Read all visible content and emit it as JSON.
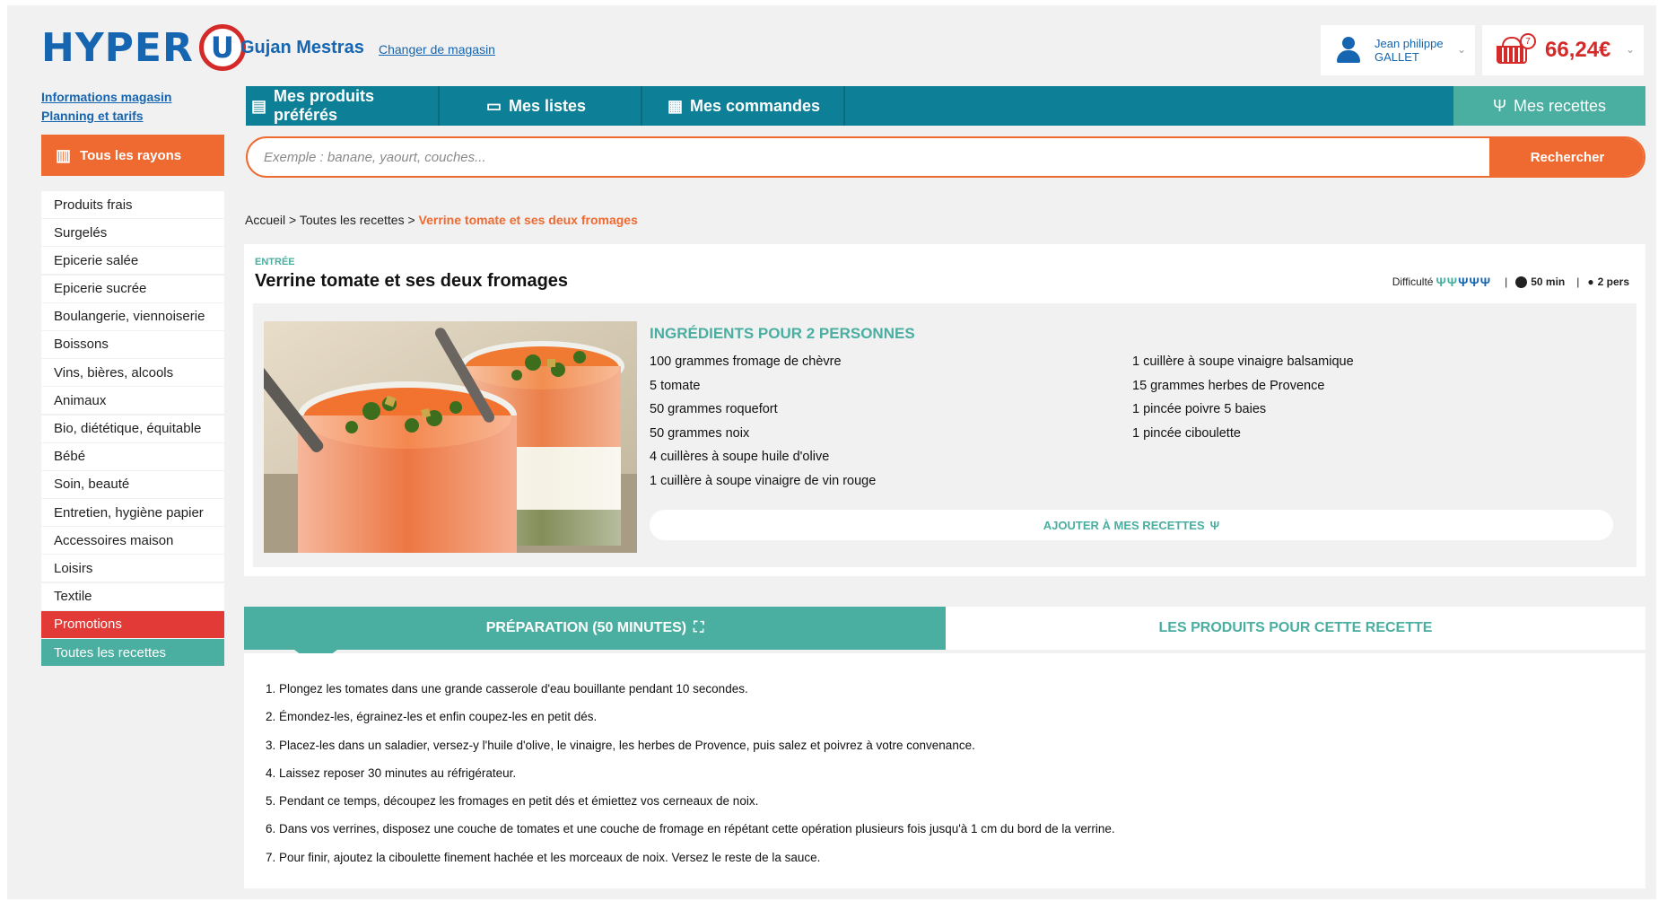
{
  "header": {
    "logo": {
      "text": "HYPER",
      "mark": "U"
    },
    "store_name": "Gujan Mestras",
    "change_store": "Changer de magasin",
    "user": {
      "first": "Jean philippe",
      "last": "GALLET"
    },
    "cart": {
      "count": "7",
      "total": "66,24€"
    }
  },
  "sidebar": {
    "info_link": "Informations magasin",
    "planning_link": "Planning et tarifs",
    "rayons_button": "Tous les rayons",
    "categories": [
      "Produits frais",
      "Surgelés",
      "Epicerie salée",
      "Epicerie sucrée",
      "Boulangerie, viennoiserie",
      "Boissons",
      "Vins, bières, alcools",
      "Animaux",
      "Bio, diététique, équitable",
      "Bébé",
      "Soin, beauté",
      "Entretien, hygiène papier",
      "Accessoires maison",
      "Loisirs",
      "Textile"
    ],
    "promotions": "Promotions",
    "all_recipes": "Toutes les recettes"
  },
  "nav": {
    "favorites": "Mes produits préférés",
    "lists": "Mes listes",
    "orders": "Mes commandes",
    "recipes": "Mes recettes"
  },
  "search": {
    "placeholder": "Exemple : banane, yaourt, couches...",
    "button": "Rechercher"
  },
  "breadcrumb": {
    "home": "Accueil",
    "sep1": " > ",
    "recipes": "Toutes les recettes",
    "sep2": " > ",
    "current": "Verrine tomate et ses deux fromages"
  },
  "recipe": {
    "category": "ENTRÉE",
    "title": "Verrine tomate et ses deux fromages",
    "difficulty_label": "Difficulté",
    "time": "50 min",
    "persons": "2 pers",
    "ingredients_title": "INGRÉDIENTS POUR 2 PERSONNES",
    "ingredients_col1": [
      "100 grammes fromage de chèvre",
      "5 tomate",
      "50 grammes roquefort",
      "50 grammes noix",
      "4 cuillères à soupe huile d'olive",
      "1 cuillère à soupe vinaigre de vin rouge"
    ],
    "ingredients_col2": [
      "1 cuillère à soupe vinaigre balsamique",
      "15 grammes herbes de Provence",
      "1 pincée poivre 5 baies",
      "1 pincée ciboulette"
    ],
    "add_button": "AJOUTER À MES RECETTES"
  },
  "tabs": {
    "preparation": "PRÉPARATION (50 MINUTES)",
    "products": "LES PRODUITS POUR CETTE RECETTE"
  },
  "steps": [
    "1. Plongez les tomates dans une grande casserole d'eau bouillante pendant 10 secondes.",
    "2. Émondez-les, égrainez-les et enfin coupez-les en petit dés.",
    "3. Placez-les dans un saladier, versez-y l'huile d'olive, le vinaigre, les herbes de Provence, puis salez et poivrez à votre convenance.",
    "4. Laissez reposer 30 minutes au réfrigérateur.",
    "5. Pendant ce temps, découpez les fromages en petit dés et émiettez vos cerneaux de noix.",
    "6. Dans vos verrines, disposez une couche de tomates et une couche de fromage en répétant cette opération plusieurs fois jusqu'à 1 cm du bord de la verrine.",
    "7. Pour finir, ajoutez la ciboulette finement hachée et les morceaux de noix. Versez le reste de la sauce."
  ],
  "icons": {
    "user": "user-icon",
    "cart": "basket-icon",
    "rayons": "shelves-icon",
    "favorites": "note-icon",
    "lists": "list-icon",
    "orders": "receipt-icon",
    "recipes": "fork-knife-icon",
    "clock": "clock-icon",
    "persons": "person-icon",
    "expand": "expand-icon"
  },
  "colors": {
    "brand_blue": "#1565b0",
    "brand_red": "#d42a2a",
    "orange": "#ee6a31",
    "teal_nav": "#0d7f96",
    "teal_accent": "#4aaea0",
    "promo_red": "#e23a36"
  }
}
